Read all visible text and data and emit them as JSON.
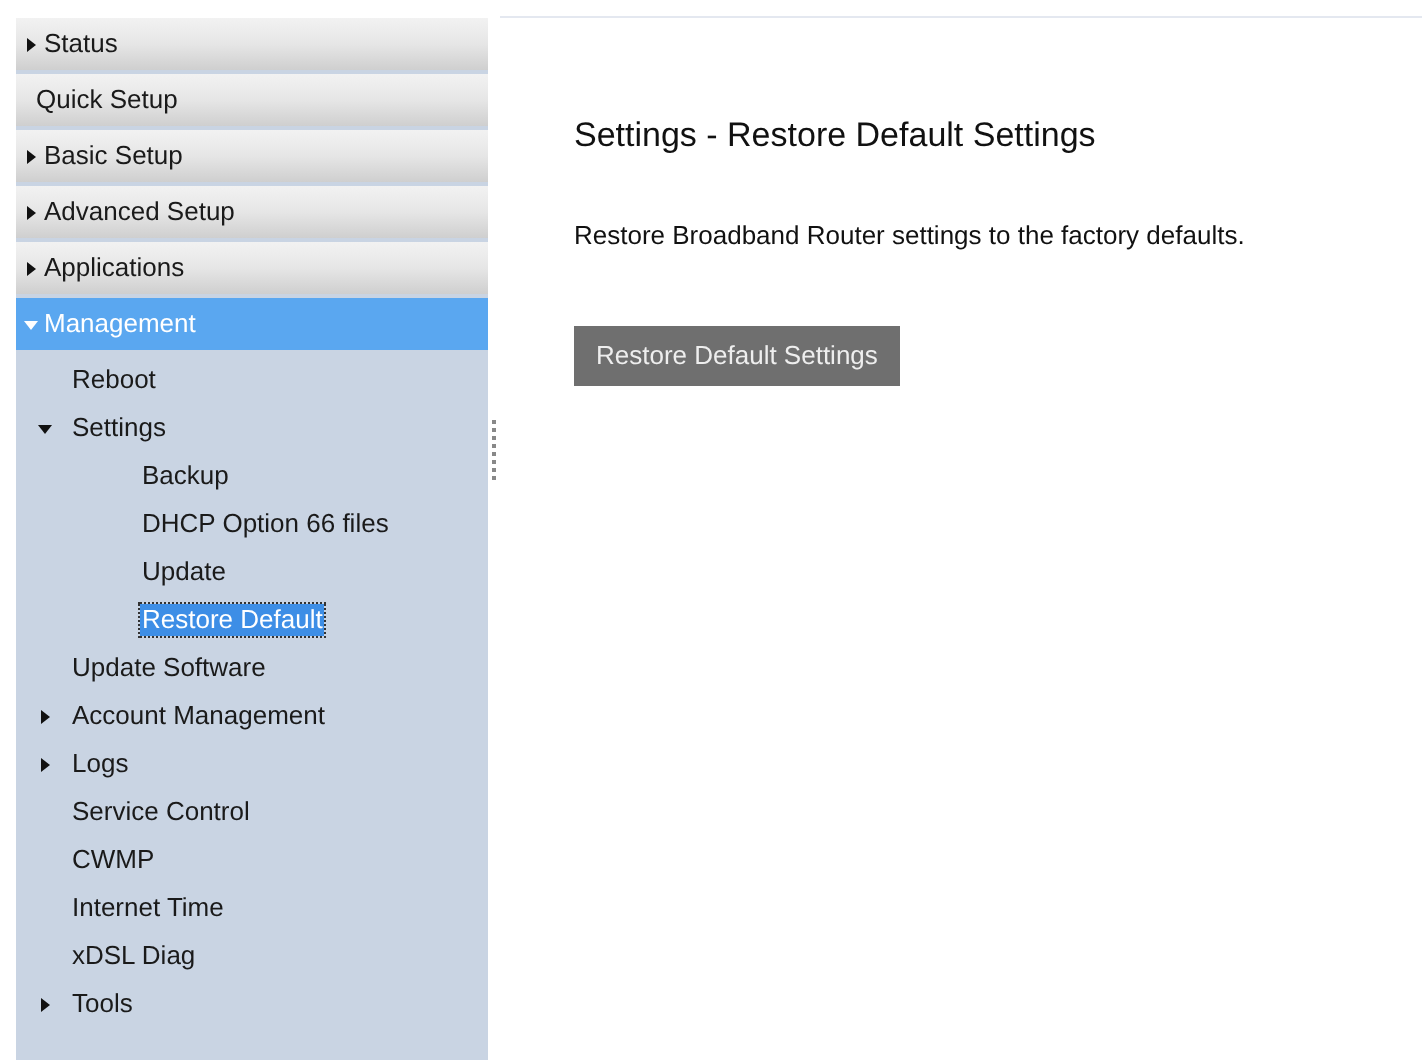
{
  "sidebar": {
    "items": [
      {
        "label": "Status",
        "kind": "collapsed",
        "selected": false
      },
      {
        "label": "Quick Setup",
        "kind": "leaf",
        "selected": false
      },
      {
        "label": "Basic Setup",
        "kind": "collapsed",
        "selected": false
      },
      {
        "label": "Advanced Setup",
        "kind": "collapsed",
        "selected": false
      },
      {
        "label": "Applications",
        "kind": "collapsed",
        "selected": false
      },
      {
        "label": "Management",
        "kind": "expanded",
        "selected": true,
        "children": [
          {
            "label": "Reboot",
            "kind": "leaf",
            "selected": false
          },
          {
            "label": "Settings",
            "kind": "expanded",
            "selected": false,
            "children": [
              {
                "label": "Backup",
                "selected": false
              },
              {
                "label": "DHCP Option 66 files",
                "selected": false
              },
              {
                "label": "Update",
                "selected": false
              },
              {
                "label": "Restore Default",
                "selected": true
              }
            ]
          },
          {
            "label": "Update Software",
            "kind": "leaf",
            "selected": false
          },
          {
            "label": "Account Management",
            "kind": "collapsed",
            "selected": false
          },
          {
            "label": "Logs",
            "kind": "collapsed",
            "selected": false
          },
          {
            "label": "Service Control",
            "kind": "leaf",
            "selected": false
          },
          {
            "label": "CWMP",
            "kind": "leaf",
            "selected": false
          },
          {
            "label": "Internet Time",
            "kind": "leaf",
            "selected": false
          },
          {
            "label": "xDSL Diag",
            "kind": "leaf",
            "selected": false
          },
          {
            "label": "Tools",
            "kind": "collapsed",
            "selected": false
          }
        ]
      }
    ]
  },
  "page": {
    "title": "Settings - Restore Default Settings",
    "description": "Restore Broadband Router settings to the factory defaults.",
    "button": "Restore Default Settings"
  }
}
